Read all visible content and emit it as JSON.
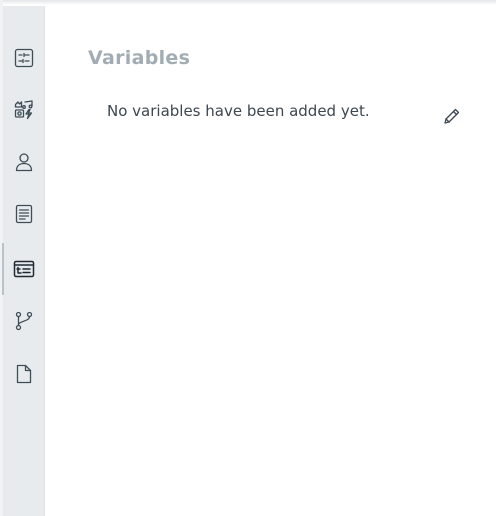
{
  "sidebar": {
    "items": [
      {
        "icon": "settings-sliders-icon",
        "active": false
      },
      {
        "icon": "media-assets-icon",
        "active": false
      },
      {
        "icon": "user-icon",
        "active": false
      },
      {
        "icon": "document-icon",
        "active": false
      },
      {
        "icon": "variables-icon",
        "active": true
      },
      {
        "icon": "branch-icon",
        "active": false
      },
      {
        "icon": "file-icon",
        "active": false
      }
    ]
  },
  "main": {
    "title": "Variables",
    "empty_message": "No variables have been added yet.",
    "edit_icon": "pencil-icon"
  },
  "colors": {
    "sidebar_bg": "#e8ebed",
    "title": "#a2acb3",
    "text": "#3c4750",
    "icon": "#3f4d57"
  }
}
